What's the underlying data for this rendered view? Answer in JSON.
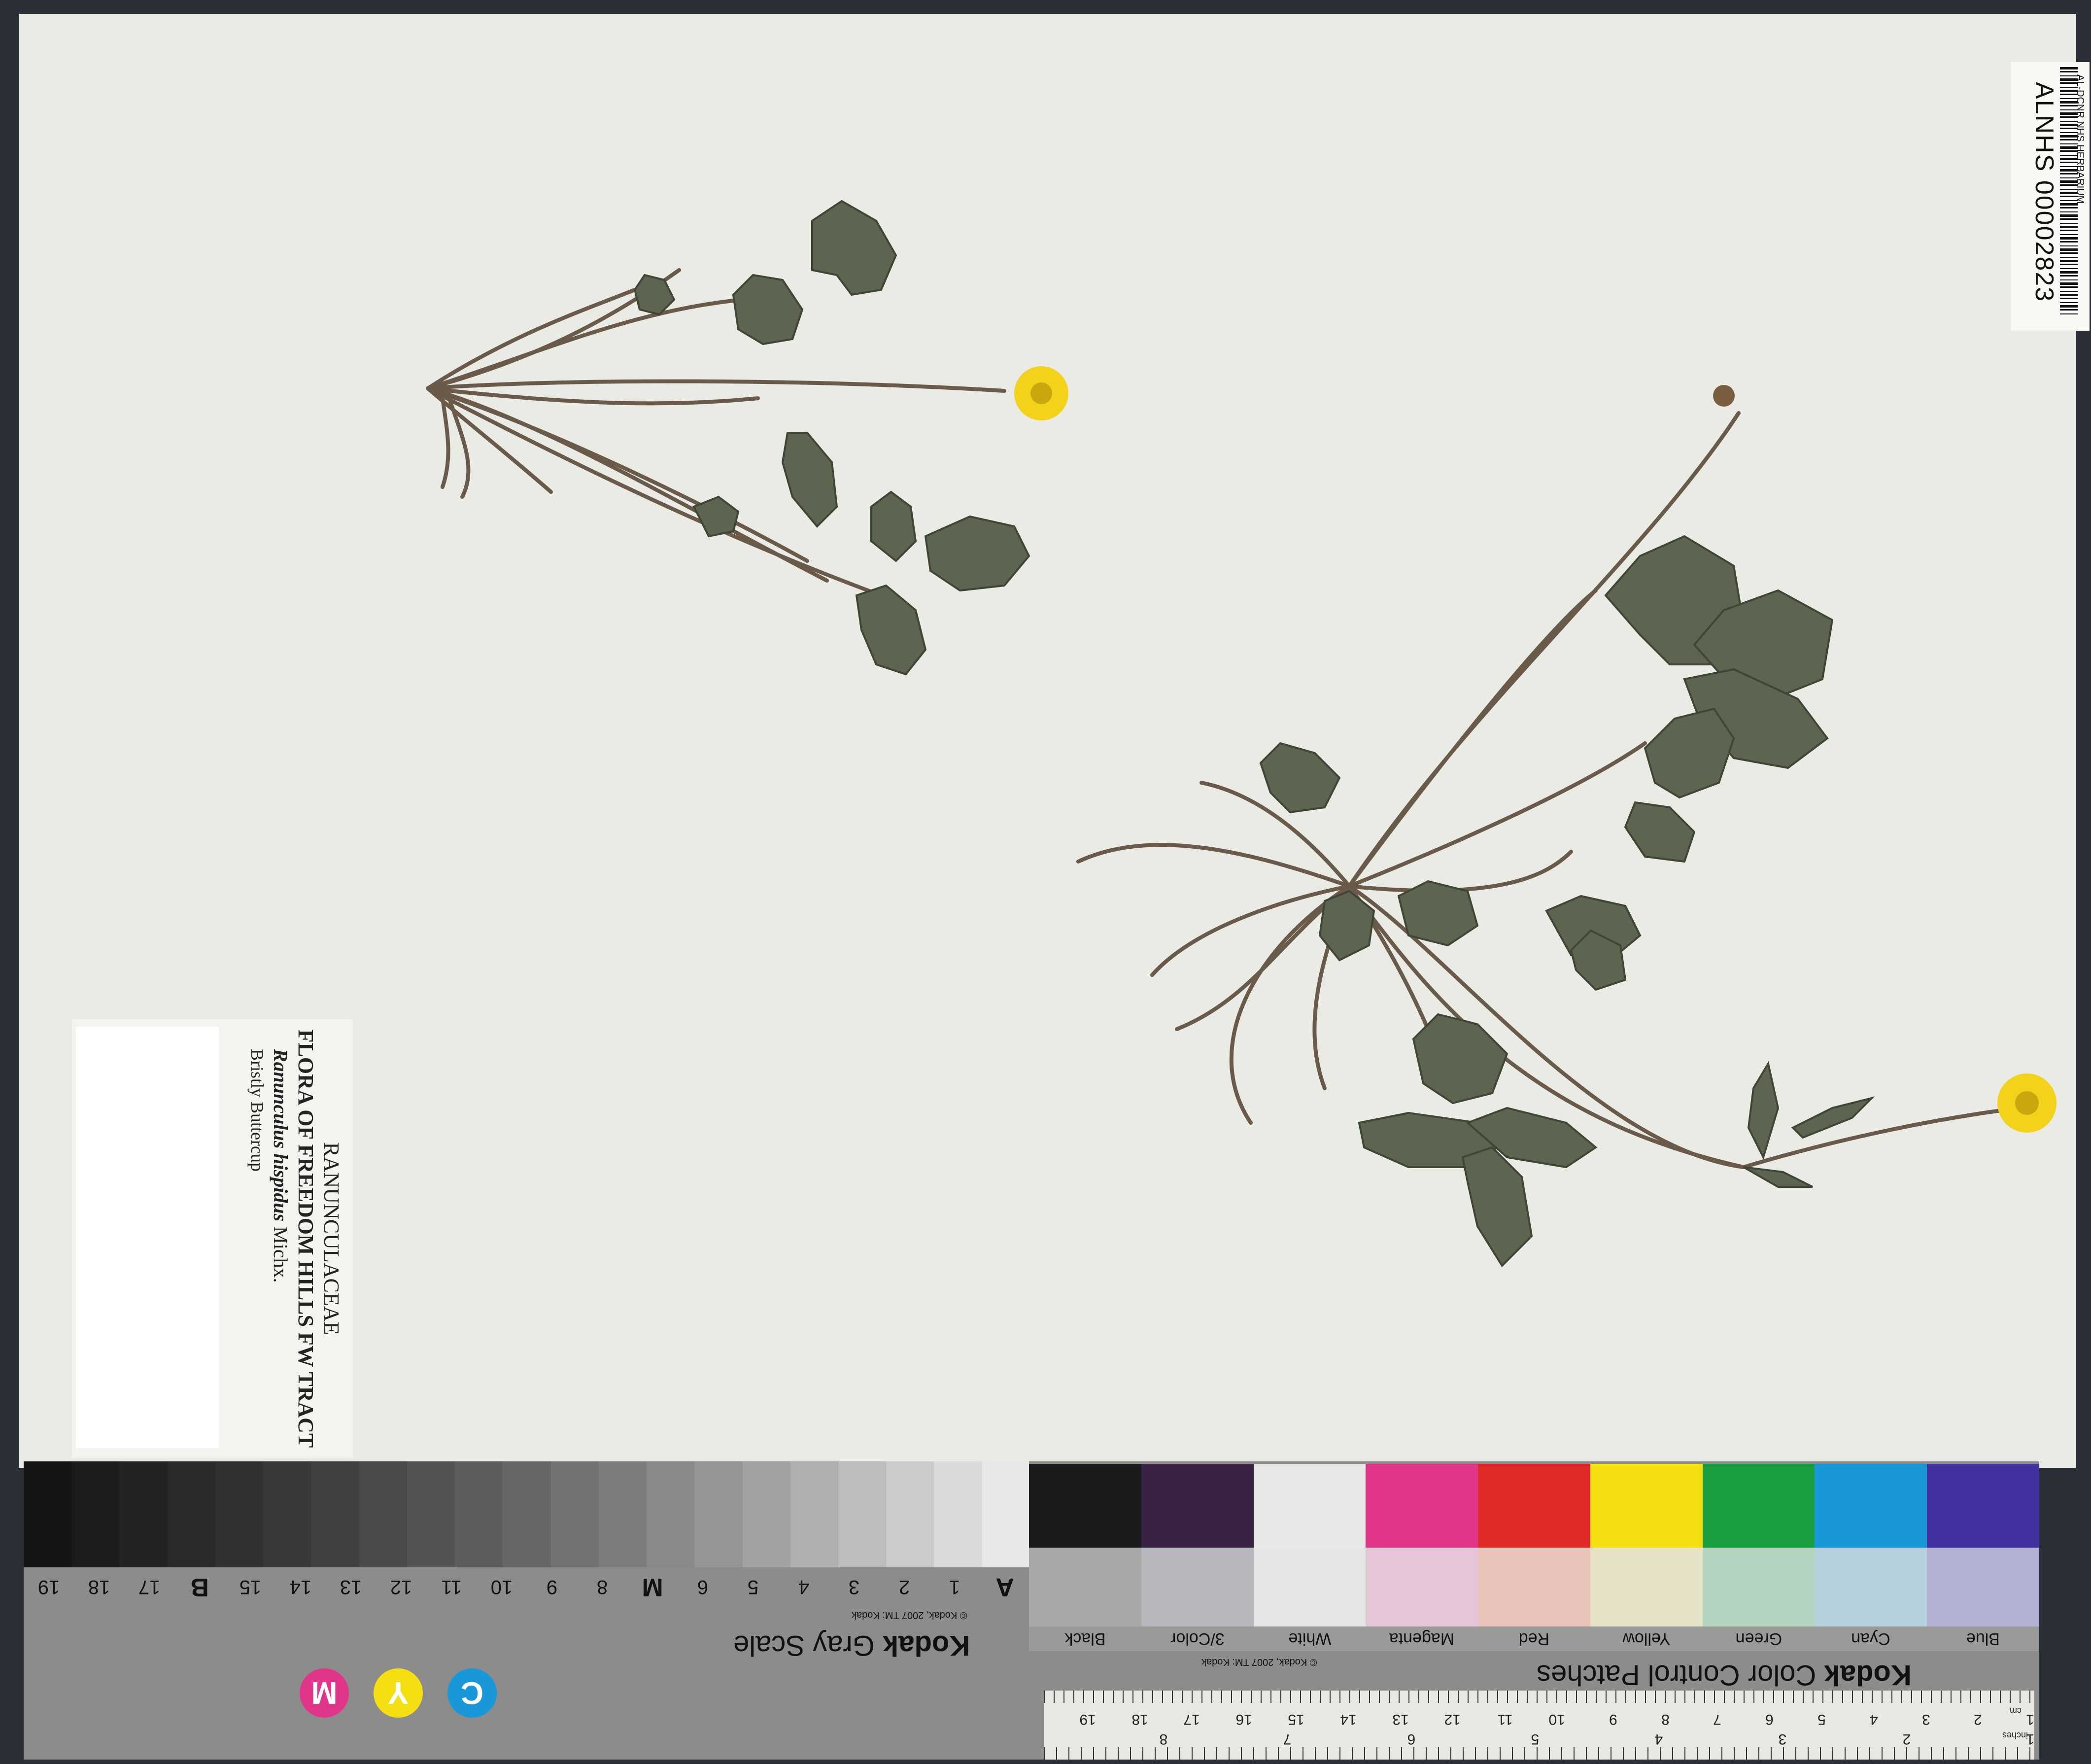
{
  "label": {
    "family": "RANUNCULACEAE",
    "flora": "FLORA OF FREEDOM HILLS FW TRACT",
    "scientific_name": "Ranunculus hispidus",
    "authority": "Michx.",
    "common_name": "Bristly Buttercup"
  },
  "barcode": {
    "herbarium": "AL-DCNR NHS HERBARIUM",
    "catalog_number": "ALNHS 00002823"
  },
  "gray_scale": {
    "title_brand": "Kodak",
    "title": "Gray Scale",
    "copyright": "© Kodak, 2007 TM: Kodak",
    "patch_labels": [
      "A",
      "1",
      "2",
      "3",
      "4",
      "5",
      "6",
      "M",
      "8",
      "9",
      "10",
      "11",
      "12",
      "13",
      "14",
      "15",
      "B",
      "17",
      "18",
      "19"
    ],
    "cym_marks": [
      "C",
      "Y",
      "M"
    ]
  },
  "color_patches": {
    "title_brand": "Kodak",
    "title": "Color Control Patches",
    "copyright": "© Kodak, 2007 TM: Kodak",
    "names": [
      "Blue",
      "Cyan",
      "Green",
      "Yellow",
      "Red",
      "Magenta",
      "White",
      "3/Color",
      "Black"
    ],
    "ruler_cm": [
      "1",
      "2",
      "3",
      "4",
      "5",
      "6",
      "7",
      "8",
      "9",
      "10",
      "11",
      "12",
      "13",
      "14",
      "15",
      "16",
      "17",
      "18",
      "19"
    ],
    "ruler_in": [
      "1",
      "2",
      "3",
      "4",
      "5",
      "6",
      "7",
      "8"
    ],
    "ruler_unit_cm": "cm",
    "ruler_unit_in": "inches"
  },
  "colors": {
    "sheet": "#ebebe6",
    "leaf": "#5d6450",
    "stem": "#6a5a4a",
    "flower": "#f2d21a",
    "gray_steps": [
      "#141414",
      "#1c1c1c",
      "#232323",
      "#2a2a2a",
      "#313131",
      "#393939",
      "#414141",
      "#4a4a4a",
      "#535353",
      "#5d5d5d",
      "#676767",
      "#727272",
      "#7d7d7d",
      "#898989",
      "#959595",
      "#a2a2a2",
      "#afafaf",
      "#bdbdbd",
      "#cbcbcb",
      "#dadada",
      "#e8e8e8"
    ],
    "color_top": [
      "#1a1a1a",
      "#3a2245",
      "#e8e8e6",
      "#e0368a",
      "#e02a2a",
      "#f4e010",
      "#18a040",
      "#1898d8",
      "#4030a0"
    ],
    "color_mid": [
      "#a8a8a8",
      "#b8b6bc",
      "#e6e6e4",
      "#e4c6d8",
      "#e8c4ba",
      "#e6e2c8",
      "#b4d4c0",
      "#b6d0dc",
      "#b4b2d4"
    ]
  }
}
